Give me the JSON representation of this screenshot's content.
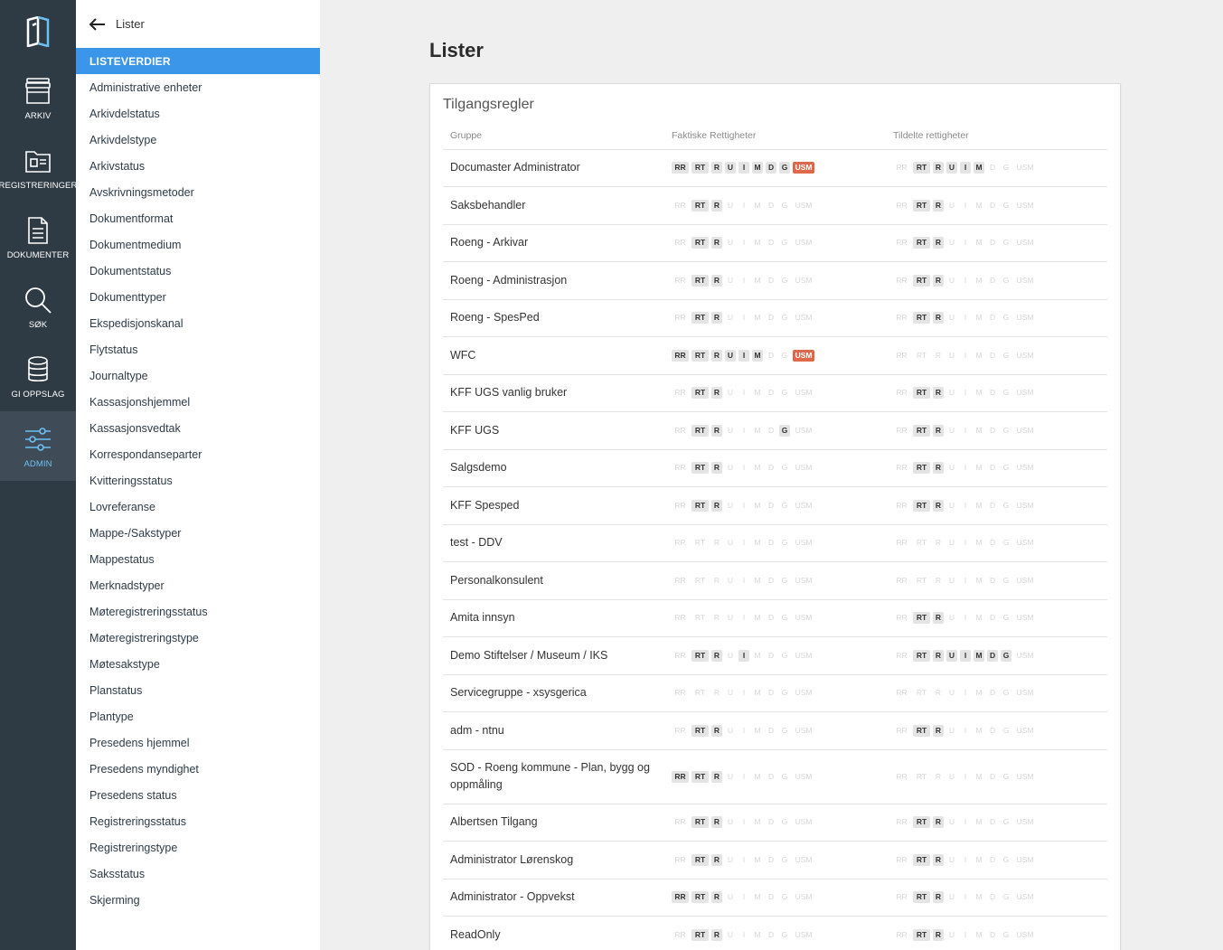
{
  "rail": {
    "items": [
      {
        "label": "ARKIV",
        "icon": "archive-icon"
      },
      {
        "label": "REGISTRERINGER",
        "icon": "folder-icon"
      },
      {
        "label": "DOKUMENTER",
        "icon": "document-icon"
      },
      {
        "label": "SØK",
        "icon": "search-icon"
      },
      {
        "label": "GI OPPSLAG",
        "icon": "database-icon"
      },
      {
        "label": "ADMIN",
        "icon": "sliders-icon",
        "active": true
      }
    ]
  },
  "sidebar": {
    "back_label": "Lister",
    "active_item": "LISTEVERDIER",
    "items": [
      "Administrative enheter",
      "Arkivdelstatus",
      "Arkivdelstype",
      "Arkivstatus",
      "Avskrivningsmetoder",
      "Dokumentformat",
      "Dokumentmedium",
      "Dokumentstatus",
      "Dokumenttyper",
      "Ekspedisjonskanal",
      "Flytstatus",
      "Journaltype",
      "Kassasjonshjemmel",
      "Kassasjonsvedtak",
      "Korrespondanseparter",
      "Kvitteringsstatus",
      "Lovreferanse",
      "Mappe-/Sakstyper",
      "Mappestatus",
      "Merknadstyper",
      "Møteregistreringsstatus",
      "Møteregistreringstype",
      "Møtesakstype",
      "Planstatus",
      "Plantype",
      "Presedens hjemmel",
      "Presedens myndighet",
      "Presedens status",
      "Registreringsstatus",
      "Registreringstype",
      "Saksstatus",
      "Skjerming"
    ]
  },
  "main": {
    "title": "Lister",
    "card_title": "Tilgangsregler",
    "columns": [
      "Gruppe",
      "Faktiske Rettigheter",
      "Tildelte rettigheter"
    ],
    "right_codes": [
      "RR",
      "RT",
      "R",
      "U",
      "I",
      "M",
      "D",
      "G",
      "USM"
    ],
    "rows": [
      {
        "name": "Documaster Administrator",
        "actual": [
          1,
          1,
          1,
          1,
          1,
          1,
          1,
          1,
          1
        ],
        "assigned": [
          0,
          1,
          1,
          1,
          1,
          1,
          0,
          0,
          0
        ]
      },
      {
        "name": "Saksbehandler",
        "actual": [
          0,
          1,
          1,
          0,
          0,
          0,
          0,
          0,
          0
        ],
        "assigned": [
          0,
          1,
          1,
          0,
          0,
          0,
          0,
          0,
          0
        ]
      },
      {
        "name": "Roeng - Arkivar",
        "actual": [
          0,
          1,
          1,
          0,
          0,
          0,
          0,
          0,
          0
        ],
        "assigned": [
          0,
          1,
          1,
          0,
          0,
          0,
          0,
          0,
          0
        ]
      },
      {
        "name": "Roeng - Administrasjon",
        "actual": [
          0,
          1,
          1,
          0,
          0,
          0,
          0,
          0,
          0
        ],
        "assigned": [
          0,
          1,
          1,
          0,
          0,
          0,
          0,
          0,
          0
        ]
      },
      {
        "name": "Roeng - SpesPed",
        "actual": [
          0,
          1,
          1,
          0,
          0,
          0,
          0,
          0,
          0
        ],
        "assigned": [
          0,
          1,
          1,
          0,
          0,
          0,
          0,
          0,
          0
        ]
      },
      {
        "name": "WFC",
        "actual": [
          1,
          1,
          1,
          1,
          1,
          1,
          0,
          0,
          1
        ],
        "assigned": [
          0,
          0,
          0,
          0,
          0,
          0,
          0,
          0,
          0
        ]
      },
      {
        "name": "KFF UGS vanlig bruker",
        "actual": [
          0,
          1,
          1,
          0,
          0,
          0,
          0,
          0,
          0
        ],
        "assigned": [
          0,
          1,
          1,
          0,
          0,
          0,
          0,
          0,
          0
        ]
      },
      {
        "name": "KFF UGS",
        "actual": [
          0,
          1,
          1,
          0,
          0,
          0,
          0,
          1,
          0
        ],
        "assigned": [
          0,
          1,
          1,
          0,
          0,
          0,
          0,
          0,
          0
        ]
      },
      {
        "name": "Salgsdemo",
        "actual": [
          0,
          1,
          1,
          0,
          0,
          0,
          0,
          0,
          0
        ],
        "assigned": [
          0,
          1,
          1,
          0,
          0,
          0,
          0,
          0,
          0
        ]
      },
      {
        "name": "KFF Spesped",
        "actual": [
          0,
          1,
          1,
          0,
          0,
          0,
          0,
          0,
          0
        ],
        "assigned": [
          0,
          1,
          1,
          0,
          0,
          0,
          0,
          0,
          0
        ]
      },
      {
        "name": "test - DDV",
        "actual": [
          0,
          0,
          0,
          0,
          0,
          0,
          0,
          0,
          0
        ],
        "assigned": [
          0,
          0,
          0,
          0,
          0,
          0,
          0,
          0,
          0
        ]
      },
      {
        "name": "Personalkonsulent",
        "actual": [
          0,
          0,
          0,
          0,
          0,
          0,
          0,
          0,
          0
        ],
        "assigned": [
          0,
          0,
          0,
          0,
          0,
          0,
          0,
          0,
          0
        ]
      },
      {
        "name": "Amita innsyn",
        "actual": [
          0,
          0,
          0,
          0,
          0,
          0,
          0,
          0,
          0
        ],
        "assigned": [
          0,
          1,
          1,
          0,
          0,
          0,
          0,
          0,
          0
        ]
      },
      {
        "name": "Demo Stiftelser / Museum / IKS",
        "actual": [
          0,
          1,
          1,
          0,
          1,
          0,
          0,
          0,
          0
        ],
        "assigned": [
          0,
          1,
          1,
          1,
          1,
          1,
          1,
          1,
          0
        ]
      },
      {
        "name": "Servicegruppe - xsysgerica",
        "actual": [
          0,
          0,
          0,
          0,
          0,
          0,
          0,
          0,
          0
        ],
        "assigned": [
          0,
          0,
          0,
          0,
          0,
          0,
          0,
          0,
          0
        ]
      },
      {
        "name": "adm - ntnu",
        "actual": [
          0,
          1,
          1,
          0,
          0,
          0,
          0,
          0,
          0
        ],
        "assigned": [
          0,
          1,
          1,
          0,
          0,
          0,
          0,
          0,
          0
        ]
      },
      {
        "name": "SOD - Roeng kommune - Plan, bygg og oppmåling",
        "actual": [
          1,
          1,
          1,
          0,
          0,
          0,
          0,
          0,
          0
        ],
        "assigned": [
          0,
          0,
          0,
          0,
          0,
          0,
          0,
          0,
          0
        ],
        "tall": true
      },
      {
        "name": "Albertsen Tilgang",
        "actual": [
          0,
          1,
          1,
          0,
          0,
          0,
          0,
          0,
          0
        ],
        "assigned": [
          0,
          1,
          1,
          0,
          0,
          0,
          0,
          0,
          0
        ]
      },
      {
        "name": "Administrator Lørenskog",
        "actual": [
          0,
          1,
          1,
          0,
          0,
          0,
          0,
          0,
          0
        ],
        "assigned": [
          0,
          1,
          1,
          0,
          0,
          0,
          0,
          0,
          0
        ]
      },
      {
        "name": "Administrator - Oppvekst",
        "actual": [
          1,
          1,
          1,
          0,
          0,
          0,
          0,
          0,
          0
        ],
        "assigned": [
          0,
          1,
          1,
          0,
          0,
          0,
          0,
          0,
          0
        ]
      },
      {
        "name": "ReadOnly",
        "actual": [
          0,
          1,
          1,
          0,
          0,
          0,
          0,
          0,
          0
        ],
        "assigned": [
          0,
          1,
          1,
          0,
          0,
          0,
          0,
          0,
          0
        ]
      }
    ]
  },
  "colors": {
    "rail_bg": "#2f3b44",
    "accent": "#3b95e8",
    "usm": "#e0684a"
  }
}
